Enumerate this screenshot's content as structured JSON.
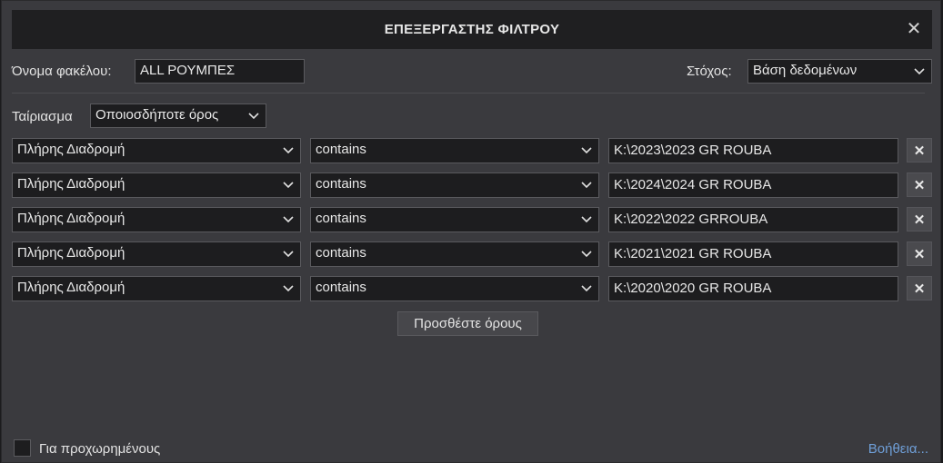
{
  "dialog": {
    "title": "ΕΠΕΞΕΡΓΑΣΤΗΣ ΦΙΛΤΡΟΥ",
    "close_glyph": "✕"
  },
  "folder": {
    "label": "Όνομα φακέλου:",
    "value": "ALL ΡΟΥΜΠΕΣ"
  },
  "target": {
    "label": "Στόχος:",
    "value": "Βάση δεδομένων"
  },
  "match": {
    "label": "Ταίριασμα",
    "value": "Οποιοσδήποτε όρος"
  },
  "rules": [
    {
      "field": "Πλήρης Διαδρομή",
      "operator": "contains",
      "value": "K:\\2023\\2023 GR ROUBA",
      "delete": "✕"
    },
    {
      "field": "Πλήρης Διαδρομή",
      "operator": "contains",
      "value": "K:\\2024\\2024 GR ROUBA",
      "delete": "✕"
    },
    {
      "field": "Πλήρης Διαδρομή",
      "operator": "contains",
      "value": "K:\\2022\\2022 GRROUBA",
      "delete": "✕"
    },
    {
      "field": "Πλήρης Διαδρομή",
      "operator": "contains",
      "value": "K:\\2021\\2021 GR ROUBA",
      "delete": "✕"
    },
    {
      "field": "Πλήρης Διαδρομή",
      "operator": "contains",
      "value": "K:\\2020\\2020 GR ROUBA",
      "delete": "✕"
    }
  ],
  "add_rule_label": "Προσθέστε όρους",
  "advanced": {
    "label": "Για προχωρημένους",
    "checked": false
  },
  "help_label": "Βοήθεια...",
  "colors": {
    "dialog_bg": "#3a3a3e",
    "titlebar_bg": "#1f1f21",
    "input_bg": "#1d1d1f",
    "link": "#6f9fd8"
  }
}
